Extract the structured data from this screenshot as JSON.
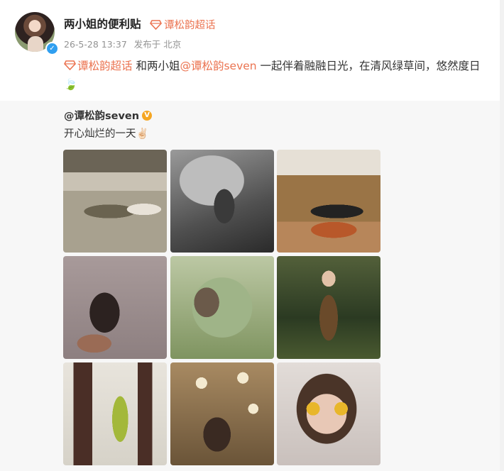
{
  "post": {
    "username": "两小姐的便利贴",
    "topic_label": "谭松韵超话",
    "timestamp": "26-5-28 13:37",
    "source": "发布于 北京",
    "text_topic": "谭松韵超话",
    "text_part1": " 和两小姐",
    "text_mention": "@谭松韵seven",
    "text_part2": " 一起伴着融融日光，在清风绿草间，悠然度日🍃"
  },
  "repost": {
    "username": "@谭松韵seven",
    "text": "开心灿烂的一天✌🏻"
  },
  "icons": {
    "avatar": "user-avatar",
    "verified": "verified-badge-icon",
    "topic": "diamond-topic-icon",
    "repost_badge": "v-badge-icon"
  },
  "colors": {
    "link": "#eb7350",
    "verified_blue": "#2f9ff0",
    "v_badge": "#f5a623",
    "meta_gray": "#939393"
  },
  "photos": [
    {
      "alt": "photo-1"
    },
    {
      "alt": "photo-2"
    },
    {
      "alt": "photo-3"
    },
    {
      "alt": "photo-4"
    },
    {
      "alt": "photo-5"
    },
    {
      "alt": "photo-6"
    },
    {
      "alt": "photo-7"
    },
    {
      "alt": "photo-8"
    },
    {
      "alt": "photo-9"
    }
  ]
}
